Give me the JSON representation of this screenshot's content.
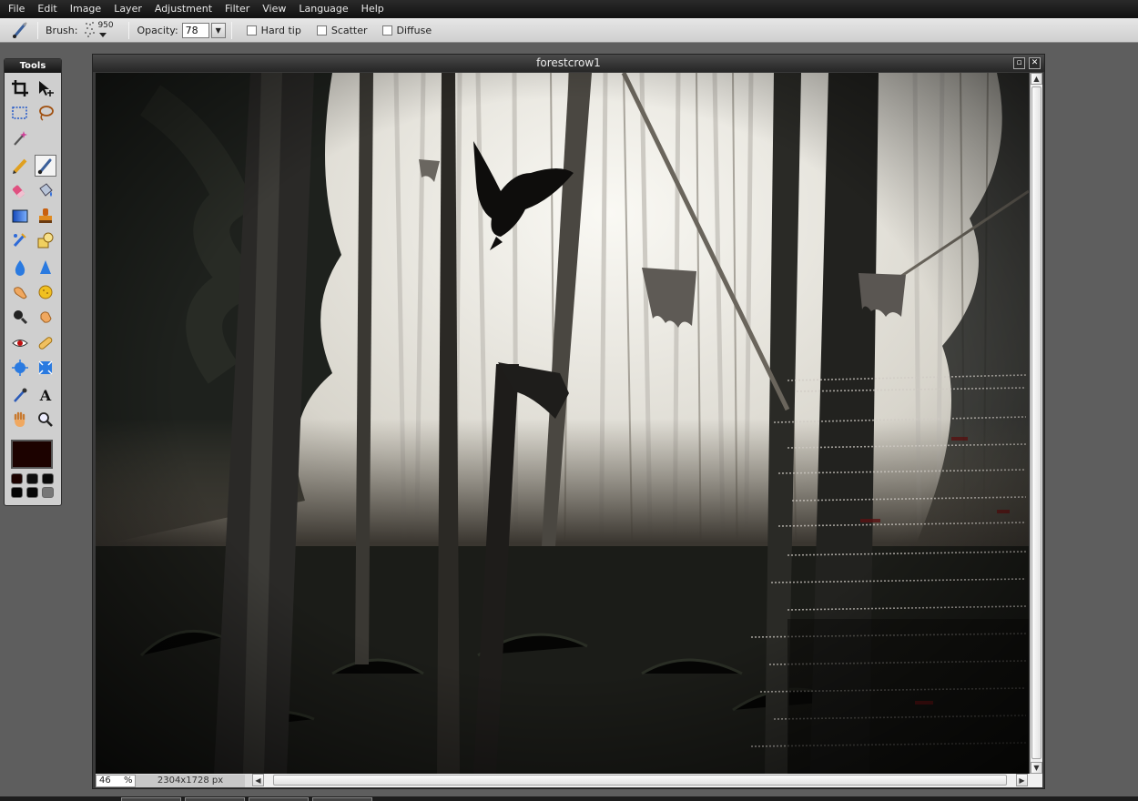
{
  "menu": [
    "File",
    "Edit",
    "Image",
    "Layer",
    "Adjustment",
    "Filter",
    "View",
    "Language",
    "Help"
  ],
  "options_bar": {
    "brush_label": "Brush:",
    "brush_size": "950",
    "opacity_label": "Opacity:",
    "opacity_value": "78",
    "checkboxes": [
      {
        "label": "Hard tip",
        "checked": false
      },
      {
        "label": "Scatter",
        "checked": false
      },
      {
        "label": "Diffuse",
        "checked": false
      }
    ]
  },
  "tools_panel": {
    "title": "Tools",
    "active_tool": "brush",
    "foreground_color": "#1c0200"
  },
  "document": {
    "title": "forestcrow1",
    "zoom": "46",
    "zoom_unit": "%",
    "dimensions": "2304x1728 px"
  }
}
